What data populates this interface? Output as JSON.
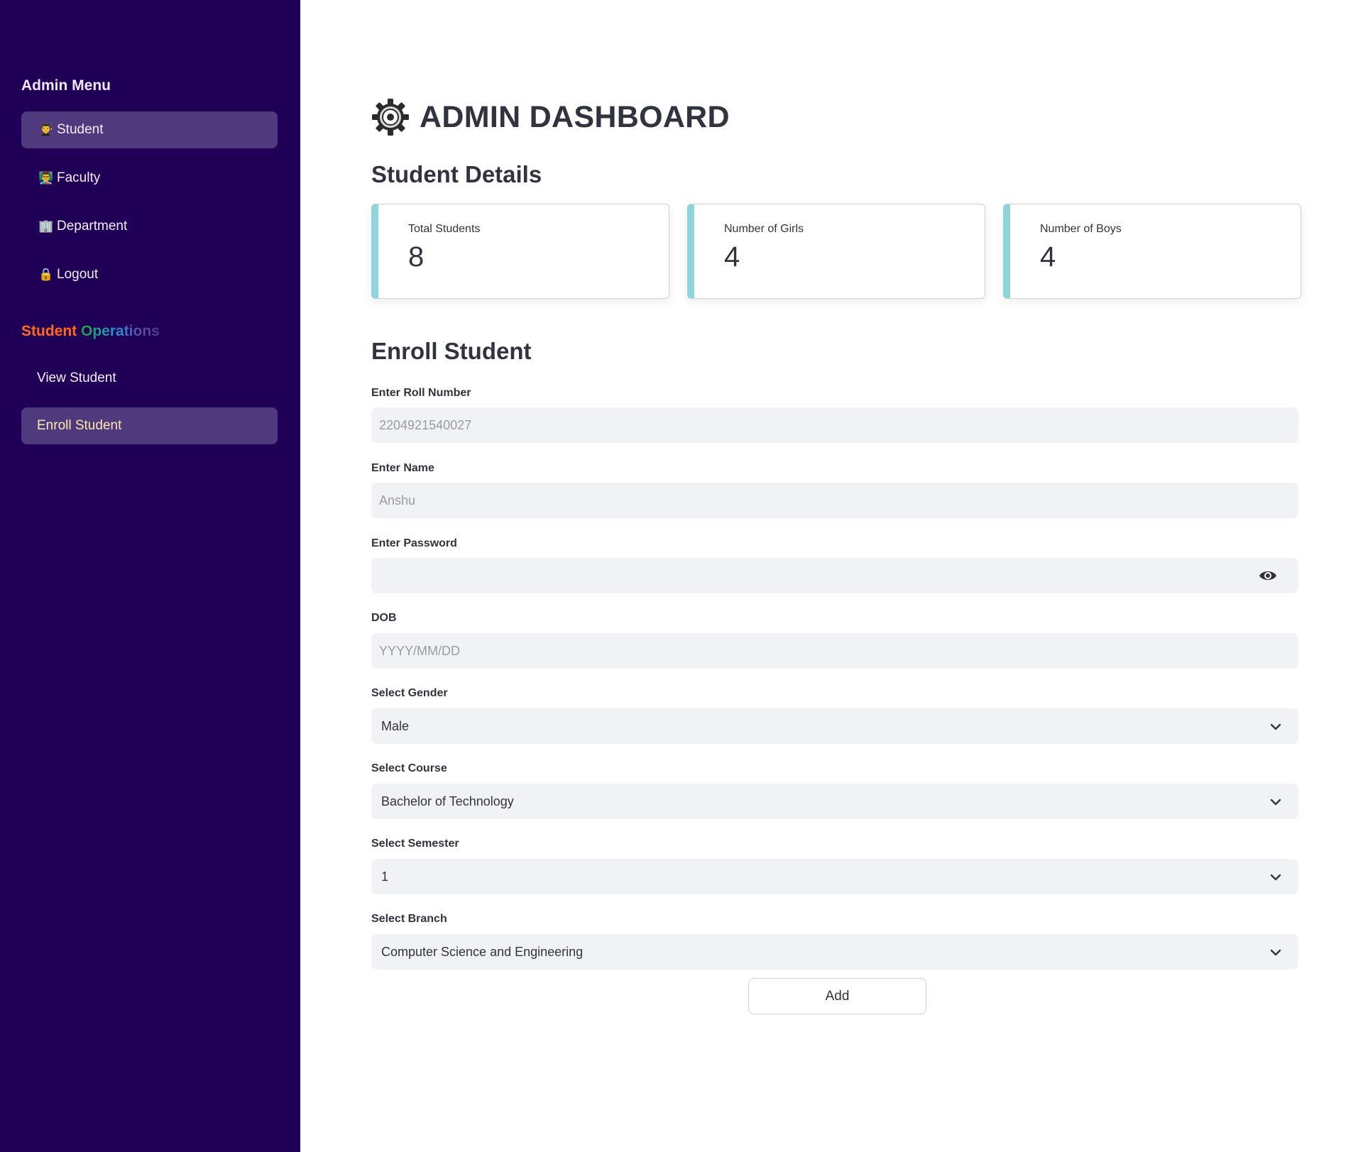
{
  "sidebar": {
    "menu_title": "Admin Menu",
    "items": [
      {
        "label": "Student",
        "icon": "student-icon",
        "glyph": "👨‍🎓"
      },
      {
        "label": "Faculty",
        "icon": "faculty-icon",
        "glyph": "👨‍🏫"
      },
      {
        "label": "Department",
        "icon": "department-icon",
        "glyph": "🏢"
      },
      {
        "label": "Logout",
        "icon": "lock-icon",
        "glyph": "🔒"
      }
    ],
    "ops_title_word1": "Student",
    "ops_title_word2": "Operations",
    "sub_items": [
      {
        "label": "View Student"
      },
      {
        "label": "Enroll Student"
      }
    ]
  },
  "header": {
    "title": "ADMIN DASHBOARD",
    "icon": "gear-icon"
  },
  "student_details": {
    "heading": "Student Details",
    "cards": [
      {
        "label": "Total Students",
        "value": "8"
      },
      {
        "label": "Number of Girls",
        "value": "4"
      },
      {
        "label": "Number of Boys",
        "value": "4"
      }
    ]
  },
  "enroll": {
    "heading": "Enroll Student",
    "roll": {
      "label": "Enter Roll Number",
      "placeholder": "2204921540027"
    },
    "name": {
      "label": "Enter Name",
      "placeholder": "Anshu"
    },
    "password": {
      "label": "Enter Password",
      "value": ""
    },
    "dob": {
      "label": "DOB",
      "placeholder": "YYYY/MM/DD"
    },
    "gender": {
      "label": "Select Gender",
      "value": "Male"
    },
    "course": {
      "label": "Select Course",
      "value": "Bachelor of Technology"
    },
    "semester": {
      "label": "Select Semester",
      "value": "1"
    },
    "branch": {
      "label": "Select Branch",
      "value": "Computer Science and Engineering"
    },
    "add_label": "Add"
  },
  "colors": {
    "sidebar_bg": "#200056",
    "nav_active": "#4e3a7c",
    "card_accent": "#8fd4dc",
    "field_bg": "#f0f2f6",
    "text": "#31333f"
  }
}
